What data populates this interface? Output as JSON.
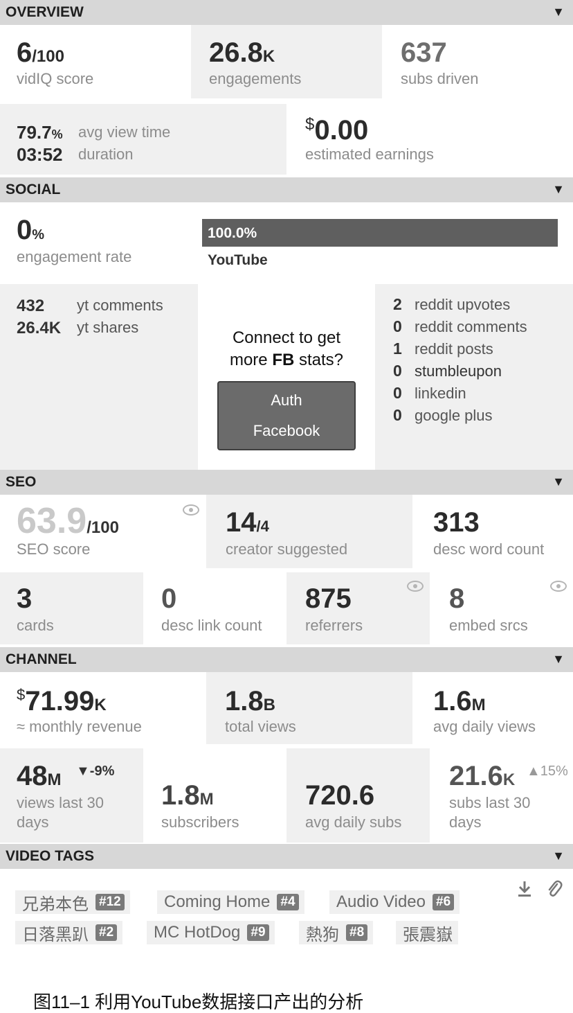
{
  "overview": {
    "title": "OVERVIEW",
    "vidiq_score": {
      "value": "6",
      "unit": "/100",
      "label": "vidIQ score"
    },
    "engagements": {
      "value": "26.8",
      "unit": "K",
      "label": "engagements"
    },
    "subs_driven": {
      "value": "637",
      "label": "subs driven"
    },
    "avg_view_time": {
      "value": "79.7",
      "unit": "%",
      "label": "avg view time"
    },
    "duration": {
      "value": "03:52",
      "label": "duration"
    },
    "earnings": {
      "currency": "$",
      "value": "0.00",
      "label": "estimated earnings"
    }
  },
  "social": {
    "title": "SOCIAL",
    "engagement_rate": {
      "value": "0",
      "unit": "%",
      "label": "engagement rate"
    },
    "youtube_bar": {
      "percent_text": "100.0%",
      "label": "YouTube",
      "fraction": 1.0
    },
    "yt_comments": {
      "value": "432",
      "label": "yt comments"
    },
    "yt_shares": {
      "value": "26.4K",
      "label": "yt shares"
    },
    "connect_line1": "Connect to get",
    "connect_line2_prefix": "more ",
    "connect_line2_bold": "FB",
    "connect_line2_suffix": " stats?",
    "auth_line1": "Auth",
    "auth_line2": "Facebook",
    "stats": [
      {
        "value": "2",
        "label": "reddit upvotes"
      },
      {
        "value": "0",
        "label": "reddit comments"
      },
      {
        "value": "1",
        "label": "reddit posts"
      },
      {
        "value": "0",
        "label": "stumbleupon"
      },
      {
        "value": "0",
        "label": "linkedin"
      },
      {
        "value": "0",
        "label": "google plus"
      }
    ]
  },
  "seo": {
    "title": "SEO",
    "seo_score": {
      "value": "63.9",
      "unit": "/100",
      "label": "SEO score"
    },
    "creator_suggested": {
      "value": "14",
      "unit": "/4",
      "label": "creator suggested"
    },
    "desc_word_count": {
      "value": "313",
      "label": "desc word count"
    },
    "cards": {
      "value": "3",
      "label": "cards"
    },
    "desc_link_count": {
      "value": "0",
      "label": "desc link count"
    },
    "referrers": {
      "value": "875",
      "label": "referrers"
    },
    "embed_srcs": {
      "value": "8",
      "label": "embed srcs"
    }
  },
  "channel": {
    "title": "CHANNEL",
    "monthly_revenue": {
      "currency": "$",
      "value": "71.99",
      "unit": "K",
      "label": "≈ monthly revenue"
    },
    "total_views": {
      "value": "1.8",
      "unit": "B",
      "label": "total views"
    },
    "avg_daily_views": {
      "value": "1.6",
      "unit": "M",
      "label": "avg daily views"
    },
    "views_last_30": {
      "value": "48",
      "unit": "M",
      "change": "▼-9%",
      "label_line1": "views last 30",
      "label_line2": "days"
    },
    "subscribers": {
      "value": "1.8",
      "unit": "M",
      "label": "subscribers"
    },
    "avg_daily_subs": {
      "value": "720.6",
      "label": "avg daily subs"
    },
    "subs_last_30": {
      "value": "21.6",
      "unit": "K",
      "change": "▲15%",
      "label_line1": "subs last 30",
      "label_line2": "days"
    }
  },
  "video_tags": {
    "title": "VIDEO TAGS",
    "tags": [
      {
        "text": "兄弟本色",
        "rank": "#12"
      },
      {
        "text": "Coming Home",
        "rank": "#4"
      },
      {
        "text": "Audio Video",
        "rank": "#6"
      },
      {
        "text": "日落黑趴",
        "rank": "#2"
      },
      {
        "text": "MC HotDog",
        "rank": "#9"
      },
      {
        "text": "熱狗",
        "rank": "#8"
      },
      {
        "text": "張震嶽",
        "rank": ""
      }
    ]
  },
  "caption": "图11–1 利用YouTube数据接口产出的分析"
}
